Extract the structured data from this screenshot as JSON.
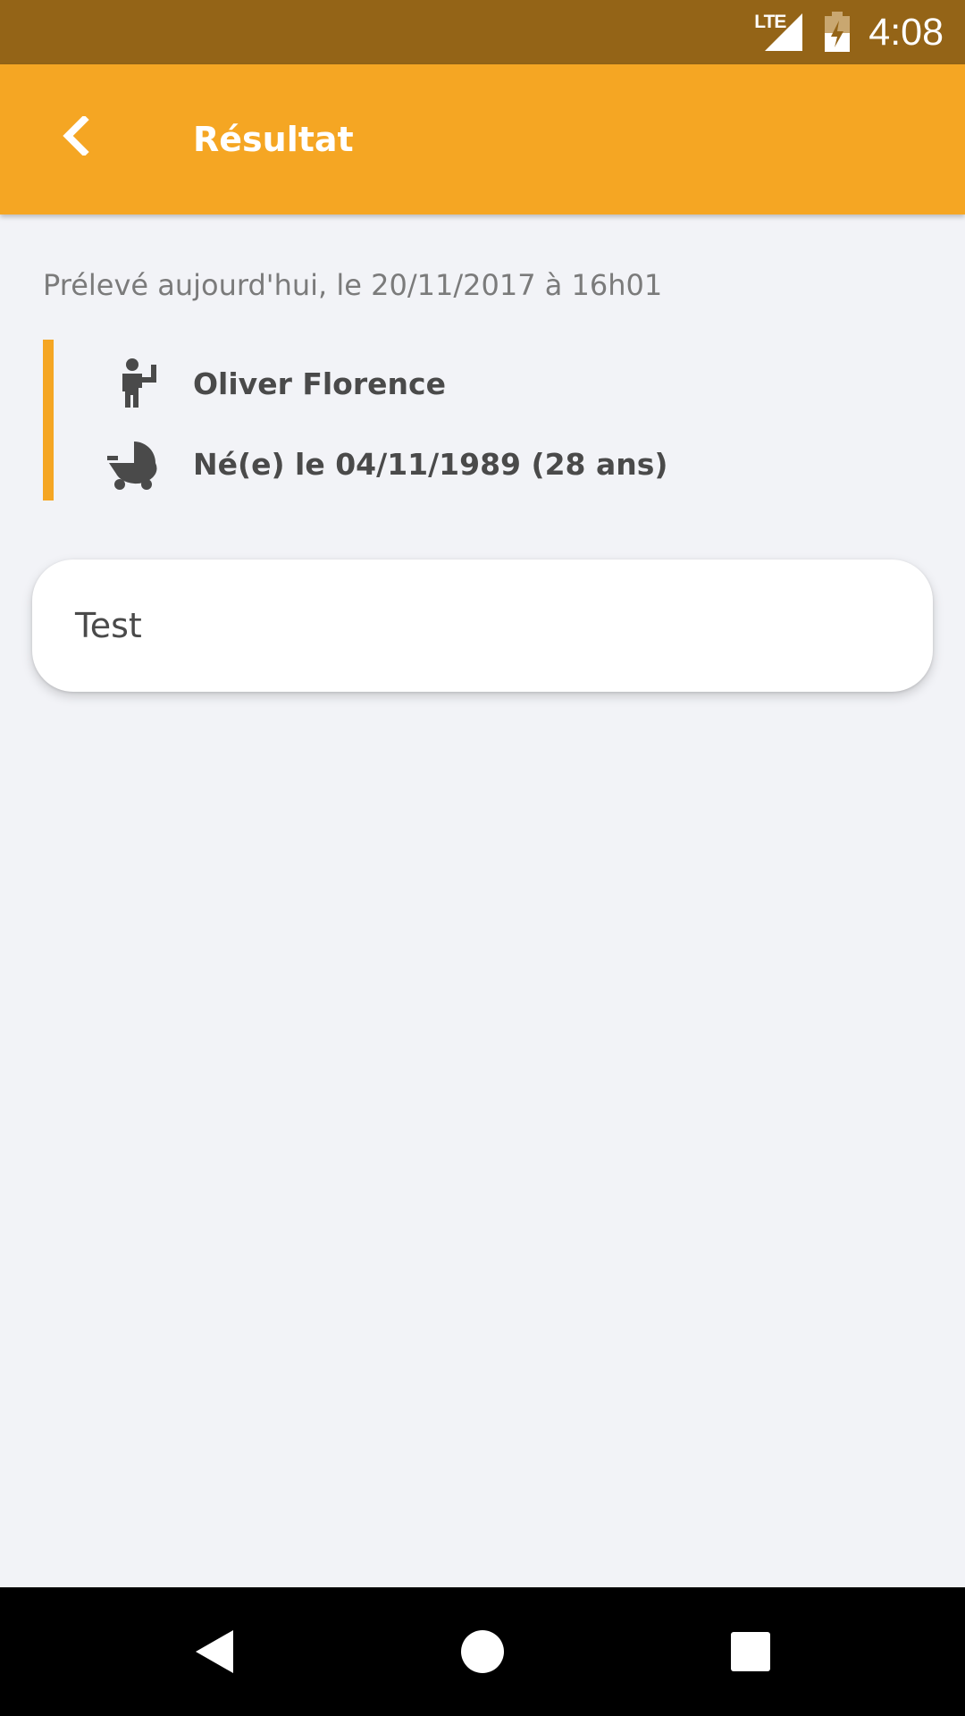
{
  "status_bar": {
    "network_label": "LTE",
    "time": "4:08",
    "icons": [
      "lte-signal-icon",
      "battery-charging-icon"
    ]
  },
  "app_bar": {
    "title": "Résultat",
    "back_icon": "chevron-left-icon"
  },
  "sample": {
    "collected_text": "Prélevé aujourd'hui, le 20/11/2017 à 16h01"
  },
  "patient": {
    "name": "Oliver Florence",
    "birth": "Né(e) le 04/11/1989 (28 ans)",
    "name_icon": "person-icon",
    "birth_icon": "stroller-icon"
  },
  "test_card": {
    "label": "Test"
  },
  "nav_bar": {
    "icons": [
      "back-triangle-icon",
      "home-circle-icon",
      "recents-square-icon"
    ]
  },
  "colors": {
    "status_bar": "#946417",
    "accent": "#f5a623",
    "background": "#f2f3f7",
    "text_dark": "#4a4a4a",
    "text_muted": "#7b7b7b"
  }
}
